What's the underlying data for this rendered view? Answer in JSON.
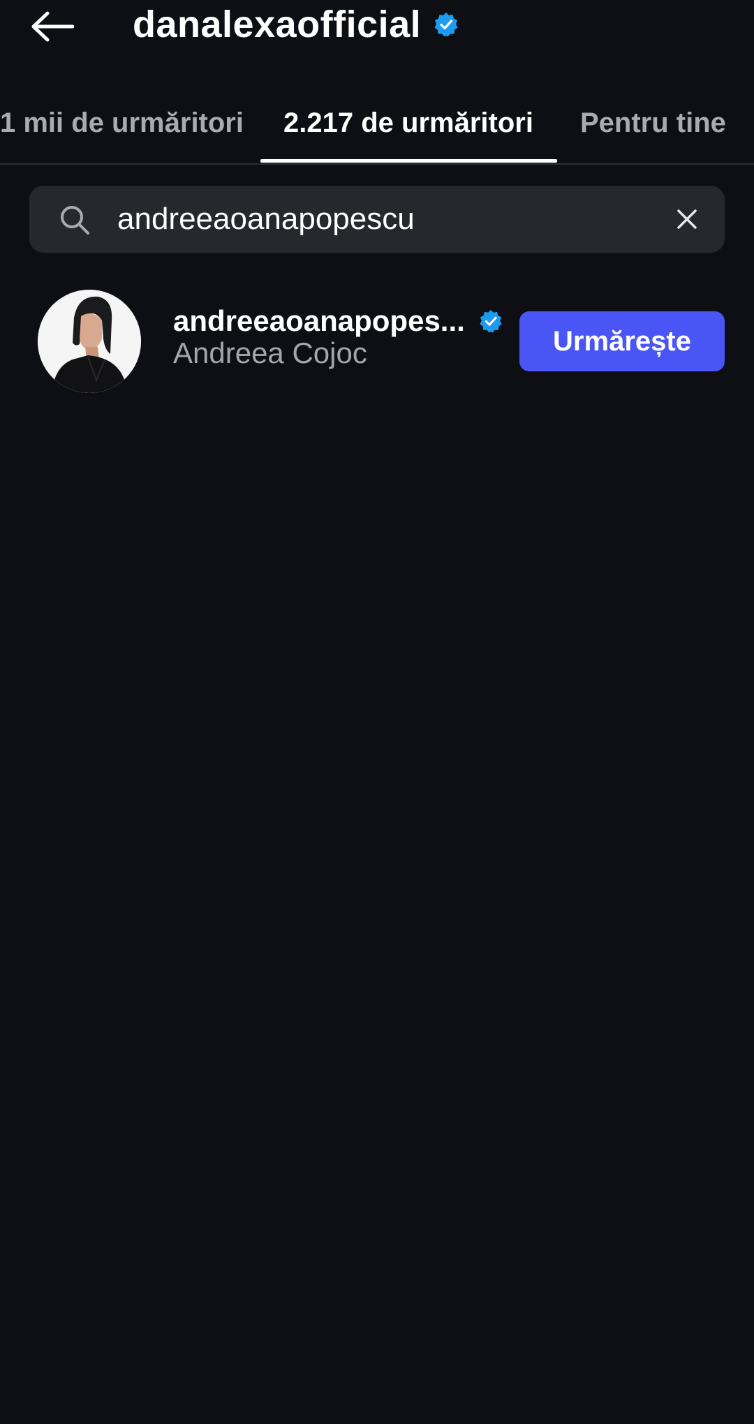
{
  "header": {
    "title": "danalexaofficial",
    "verified": true,
    "back_icon": "arrow-left-icon"
  },
  "tabs": [
    {
      "label": "1 mii de urmăritori",
      "active": false
    },
    {
      "label": "2.217 de urmăritori",
      "active": true
    },
    {
      "label": "Pentru tine",
      "active": false
    }
  ],
  "search": {
    "value": "andreeaoanapopescu",
    "search_icon": "search-icon",
    "clear_icon": "close-icon"
  },
  "results": [
    {
      "username": "andreeaoanapopes...",
      "full_name": "Andreea Cojoc",
      "verified": true,
      "button_label": "Urmărește"
    }
  ],
  "colors": {
    "background": "#0d0f14",
    "search_background": "#26282e",
    "accent_button": "#4a55f5",
    "verified_badge": "#1d9bf0",
    "secondary_text": "#a3a6ae"
  }
}
